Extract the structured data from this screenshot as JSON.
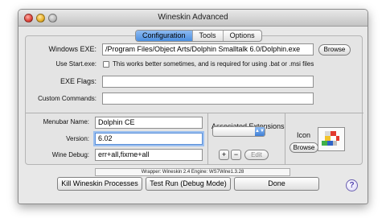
{
  "window": {
    "title": "Wineskin Advanced"
  },
  "tabs": [
    {
      "label": "Configuration",
      "active": true
    },
    {
      "label": "Tools",
      "active": false
    },
    {
      "label": "Options",
      "active": false
    }
  ],
  "exe": {
    "label": "Windows EXE:",
    "value": "/Program Files/Object Arts/Dolphin Smalltalk 6.0/Dolphin.exe",
    "browse_label": "Browse"
  },
  "start_exe": {
    "label": "Use Start.exe:",
    "checkbox_text": "This works better sometimes, and is required for using .bat or .msi files",
    "checked": false
  },
  "exe_flags": {
    "label": "EXE Flags:",
    "value": ""
  },
  "custom_commands": {
    "label": "Custom Commands:",
    "value": ""
  },
  "menubar": {
    "label": "Menubar Name:",
    "value": "Dolphin CE"
  },
  "version": {
    "label": "Version:",
    "value": "6.02"
  },
  "wine_debug": {
    "label": "Wine Debug:",
    "value": "err+all,fixme+all"
  },
  "extensions": {
    "label": "Associated Extensions",
    "popup_value": "",
    "add_label": "+",
    "remove_label": "−",
    "edit_label": "Edit"
  },
  "icon": {
    "label": "Icon",
    "browse_label": "Browse"
  },
  "status": {
    "text": "Wrapper: Wineskin 2.4     Engine: WS7Wine1.3.28"
  },
  "buttons": {
    "kill": "Kill Wineskin Processes",
    "test": "Test Run (Debug Mode)",
    "done": "Done",
    "help": "?"
  },
  "colors": {
    "accent": "#4c8fe0",
    "focus_ring": "#9cc0f0"
  }
}
